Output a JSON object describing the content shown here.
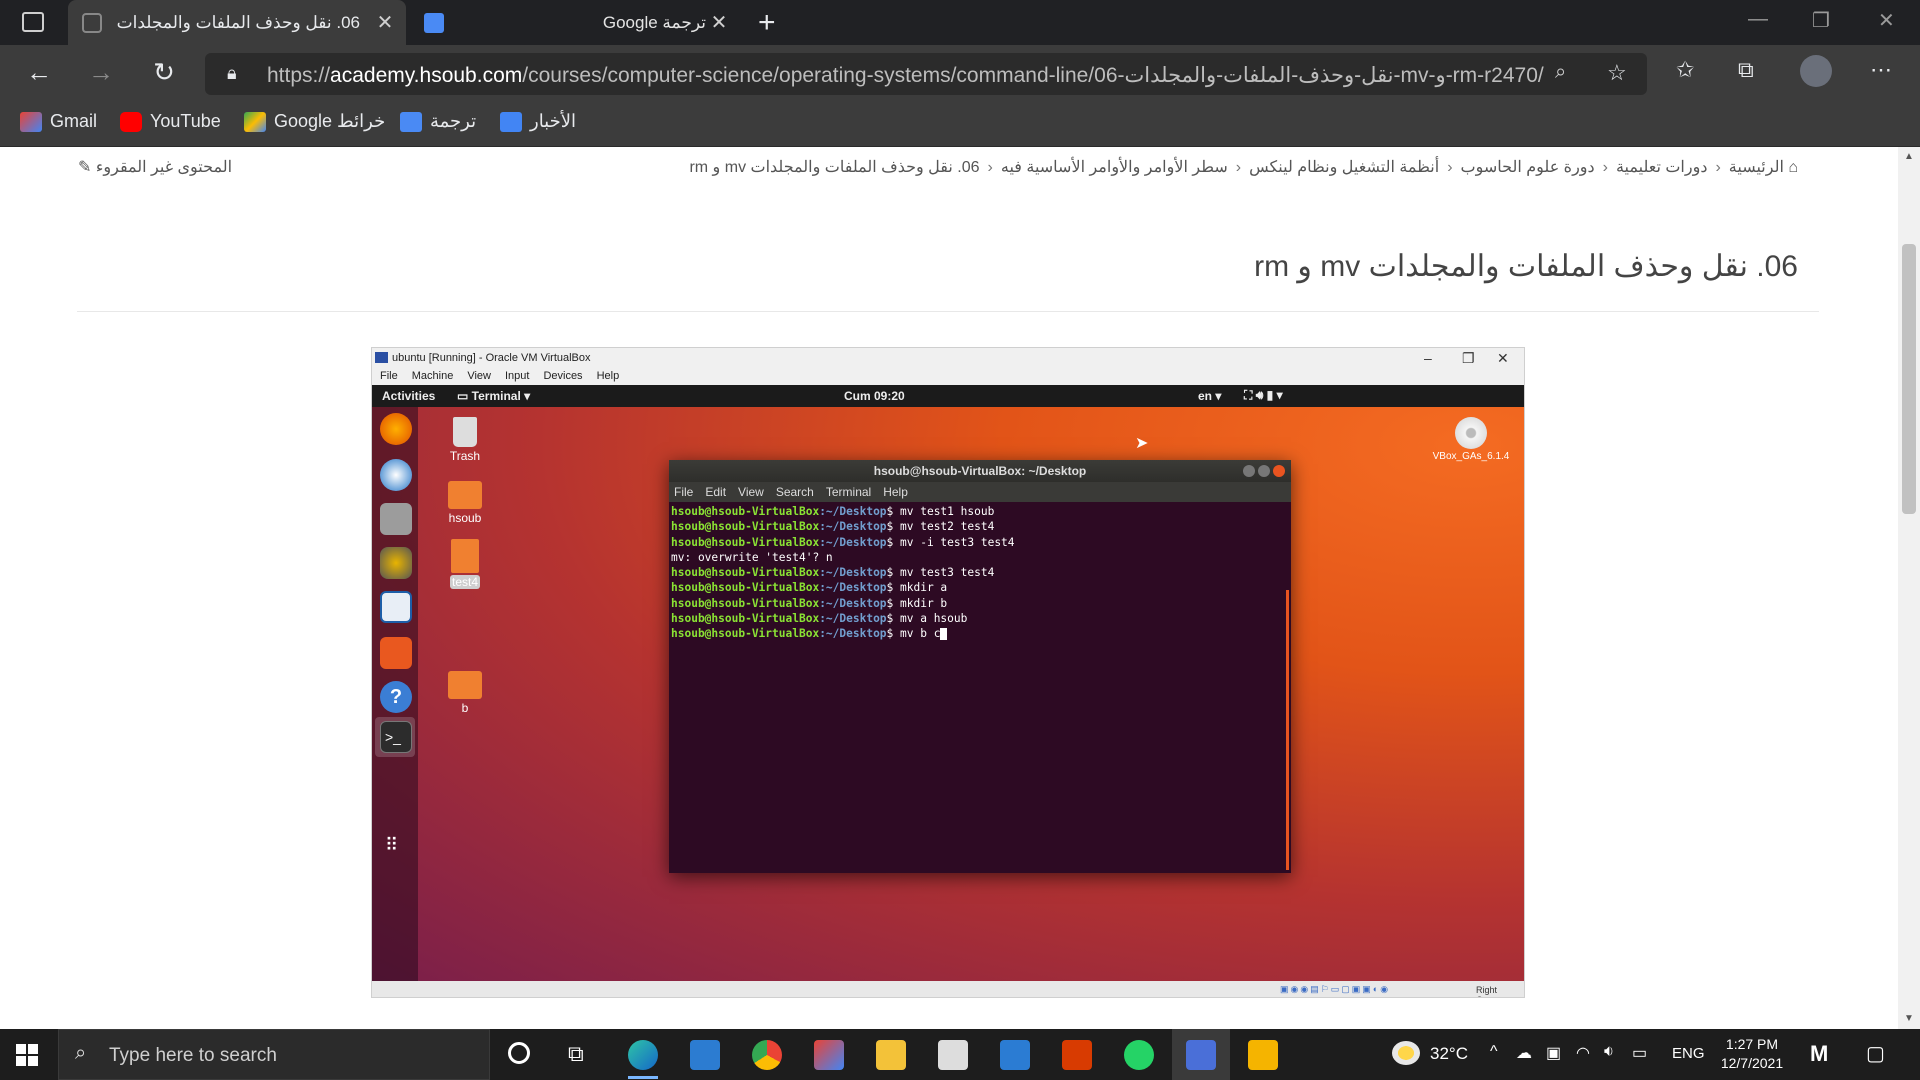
{
  "browser": {
    "tabs": [
      {
        "title": "06. نقل وحذف الملفات والمجلدات",
        "active": true
      },
      {
        "title": "ترجمة Google",
        "active": false
      }
    ],
    "url_prefix": "https://",
    "url_domain": "academy.hsoub.com",
    "url_path": "/courses/computer-science/operating-systems/command-line/06-نقل-وحذف-الملفات-والمجلدات-mv-و-rm-r2470/",
    "bookmarks": [
      "Gmail",
      "YouTube",
      "Google خرائط",
      "ترجمة",
      "الأخبار"
    ]
  },
  "page": {
    "breadcrumb": [
      "الرئيسية",
      "دورات تعليمية",
      "دورة علوم الحاسوب",
      "أنظمة التشغيل ونظام لينكس",
      "سطر الأوامر والأوامر الأساسية فيه",
      "06. نقل وحذف الملفات والمجلدات mv و rm"
    ],
    "unread_label": "المحتوى غير المقروء",
    "title": "06. نقل وحذف الملفات والمجلدات mv و rm"
  },
  "vm": {
    "window_title": "ubuntu [Running] - Oracle VM VirtualBox",
    "menus": [
      "File",
      "Machine",
      "View",
      "Input",
      "Devices",
      "Help"
    ],
    "activities": "Activities",
    "app_menu": "Terminal",
    "clock": "Cum 09:20",
    "lang": "en",
    "desktop_icons": [
      "Trash",
      "hsoub",
      "test4",
      "b"
    ],
    "vbox_disc_label": "VBox_GAs_6.1.4",
    "status_right": "Right Contro",
    "terminal": {
      "title": "hsoub@hsoub-VirtualBox: ~/Desktop",
      "menus": [
        "File",
        "Edit",
        "View",
        "Search",
        "Terminal",
        "Help"
      ],
      "prompt": "hsoub@hsoub-VirtualBox",
      "path": ":~/Desktop",
      "lines": [
        {
          "type": "cmd",
          "text": "$ mv test1 hsoub"
        },
        {
          "type": "cmd",
          "text": "$ mv test2 test4"
        },
        {
          "type": "cmd",
          "text": "$ mv -i test3 test4"
        },
        {
          "type": "out",
          "text": "mv: overwrite 'test4'? n"
        },
        {
          "type": "cmd",
          "text": "$ mv test3 test4"
        },
        {
          "type": "cmd",
          "text": "$ mkdir a"
        },
        {
          "type": "cmd",
          "text": "$ mkdir b"
        },
        {
          "type": "cmd",
          "text": "$ mv a hsoub"
        },
        {
          "type": "cmd",
          "text": "$ mv b c"
        }
      ]
    }
  },
  "taskbar": {
    "search_placeholder": "Type here to search",
    "weather": "32°C",
    "lang": "ENG",
    "time": "1:27 PM",
    "date": "12/7/2021"
  }
}
